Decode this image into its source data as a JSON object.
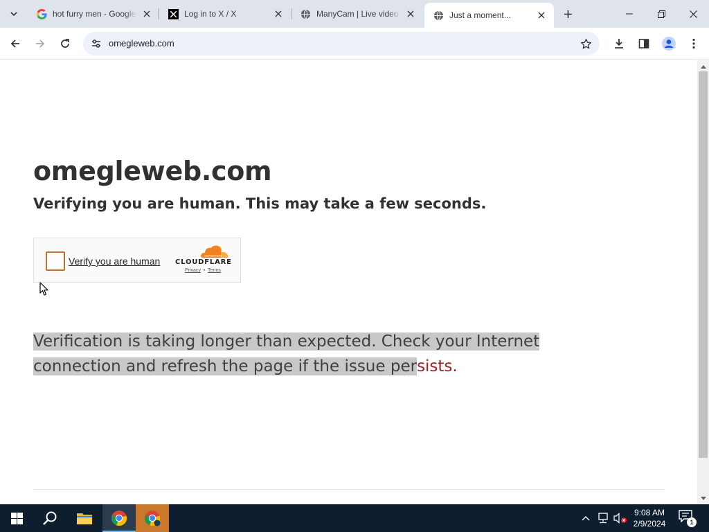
{
  "browser": {
    "tabs": [
      {
        "title": "hot furry men - Google Search",
        "icon": "google-icon",
        "active": false
      },
      {
        "title": "Log in to X / X",
        "icon": "x-logo-icon",
        "active": false
      },
      {
        "title": "ManyCam | Live video streaming",
        "icon": "globe-icon",
        "active": false
      },
      {
        "title": "Just a moment...",
        "icon": "globe-icon",
        "active": true
      }
    ],
    "url": "omegleweb.com"
  },
  "page": {
    "domain_heading": "omegleweb.com",
    "subheading": "Verifying you are human. This may take a few seconds.",
    "widget": {
      "checkbox_label": "Verify you are human",
      "brand": "CLOUDFLARE",
      "privacy_label": "Privacy",
      "separator": "•",
      "terms_label": "Terms"
    },
    "message_highlighted": "Verification is taking longer than expected. Check your Internet connection and refresh the page if the issue per",
    "message_rest": "sists."
  },
  "taskbar": {
    "time": "9:08 AM",
    "date": "2/9/2024",
    "notification_count": "1"
  },
  "colors": {
    "tabstrip_bg": "#dfe3eb",
    "omnibox_bg": "#edf1f9",
    "heading_text": "#313131",
    "message_text": "#9b2222",
    "highlight_bg": "#c8c8c8",
    "cloudflare_orange": "#f48120",
    "taskbar_bg": "#0f1e2e"
  }
}
